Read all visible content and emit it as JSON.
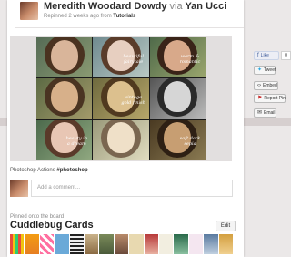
{
  "pin": {
    "author": "Meredith Woodard Dowdy",
    "via_word": "via",
    "via_user": "Yan Ucci",
    "repinned_prefix": "Repinned 2 weeks ago from",
    "repinned_board": "Tutorials",
    "image_labels": {
      "l1": "",
      "l2": "beautiful fairytale",
      "l3": "warm & romantic",
      "l4": "",
      "l5": "vintage gold finish",
      "l6": "",
      "l7": "beauty in a dream",
      "l8": "",
      "l9": "soft dark sepia"
    },
    "caption_text": "Photoshop Actions",
    "caption_tag": "#photoshop"
  },
  "comment": {
    "placeholder": "Add a comment..."
  },
  "board": {
    "pinned_label": "Pinned onto the board",
    "name": "Cuddlebug Cards",
    "edit_label": "Edit"
  },
  "side": {
    "like_label": "Like",
    "like_count": "0",
    "tweet_label": "Tweet",
    "embed_label": "Embed",
    "report_label": "Report Pin",
    "email_label": "Email"
  },
  "icons": {
    "facebook": "facebook-icon",
    "twitter": "twitter-icon",
    "embed": "embed-icon",
    "flag": "flag-icon",
    "email": "email-icon"
  }
}
